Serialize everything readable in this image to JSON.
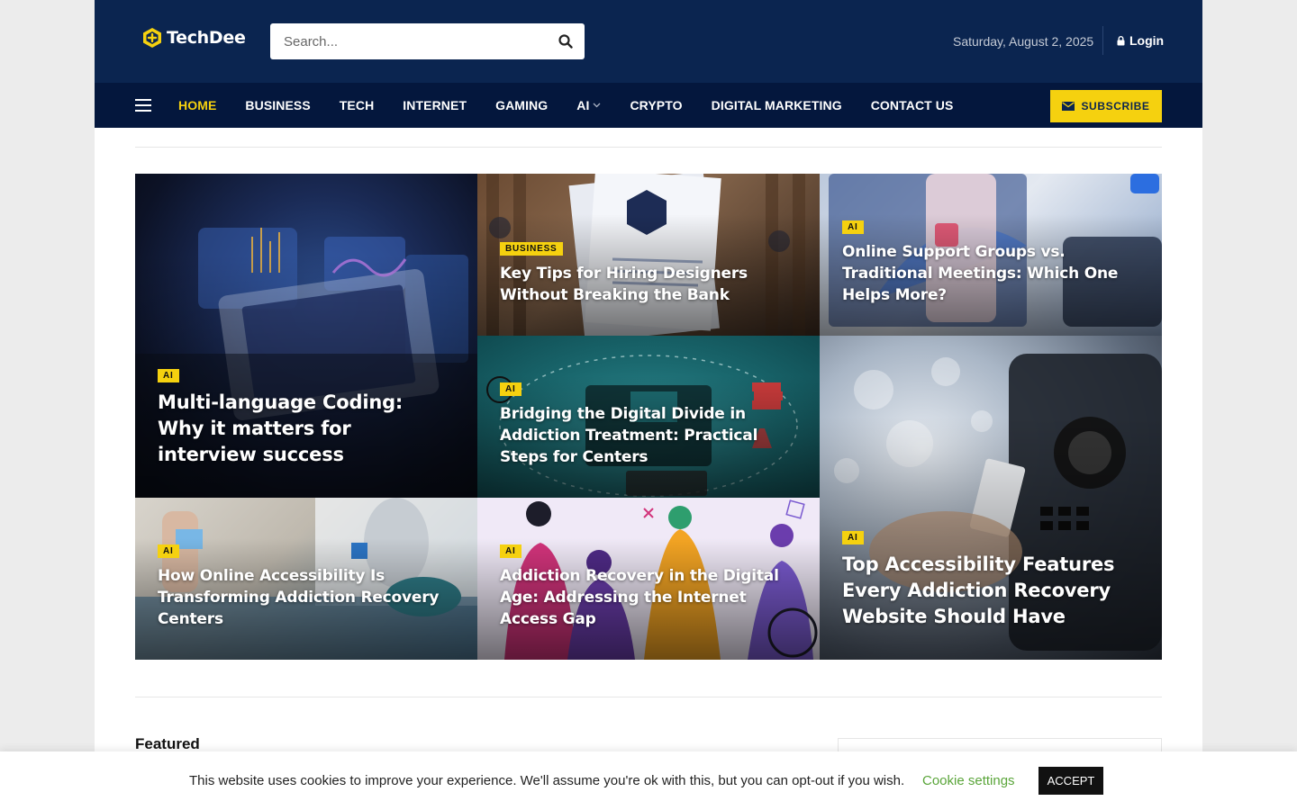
{
  "header": {
    "logo_text": "TechDee",
    "search_placeholder": "Search...",
    "date": "Saturday, August 2, 2025",
    "login_label": "Login"
  },
  "nav": {
    "items": [
      {
        "label": "HOME",
        "active": true
      },
      {
        "label": "BUSINESS"
      },
      {
        "label": "TECH"
      },
      {
        "label": "INTERNET"
      },
      {
        "label": "GAMING"
      },
      {
        "label": "AI",
        "has_dropdown": true
      },
      {
        "label": "CRYPTO"
      },
      {
        "label": "DIGITAL MARKETING"
      },
      {
        "label": "CONTACT US"
      }
    ],
    "subscribe_label": "SUBSCRIBE"
  },
  "hero": {
    "tiles": [
      {
        "category": "AI",
        "title": "Multi-language Coding: Why it matters for interview success"
      },
      {
        "category": "BUSINESS",
        "title": "Key Tips for Hiring Designers Without Breaking the Bank"
      },
      {
        "category": "AI",
        "title": "Online Support Groups vs. Traditional Meetings: Which One Helps More?"
      },
      {
        "category": "AI",
        "title": "Bridging the Digital Divide in Addiction Treatment: Practical Steps for Centers"
      },
      {
        "category": "AI",
        "title": "Top Accessibility Features Every Addiction Recovery Website Should Have"
      },
      {
        "category": "AI",
        "title": "How Online Accessibility Is Transforming Addiction Recovery Centers"
      },
      {
        "category": "AI",
        "title": "Addiction Recovery in the Digital Age: Addressing the Internet Access Gap"
      }
    ]
  },
  "section": {
    "featured_label": "Featured"
  },
  "cookie": {
    "message": "This website uses cookies to improve your experience. We'll assume you're ok with this, but you can opt-out if you wish.",
    "settings_label": "Cookie settings",
    "accept_label": "ACCEPT"
  },
  "colors": {
    "header_bg": "#0b2550",
    "nav_bg": "#04173d",
    "accent": "#f5d10f",
    "cookie_link": "#5aa53a"
  },
  "icons": [
    "logo-hex-icon",
    "search-icon",
    "lock-icon",
    "hamburger-icon",
    "chevron-down-icon",
    "envelope-icon"
  ]
}
